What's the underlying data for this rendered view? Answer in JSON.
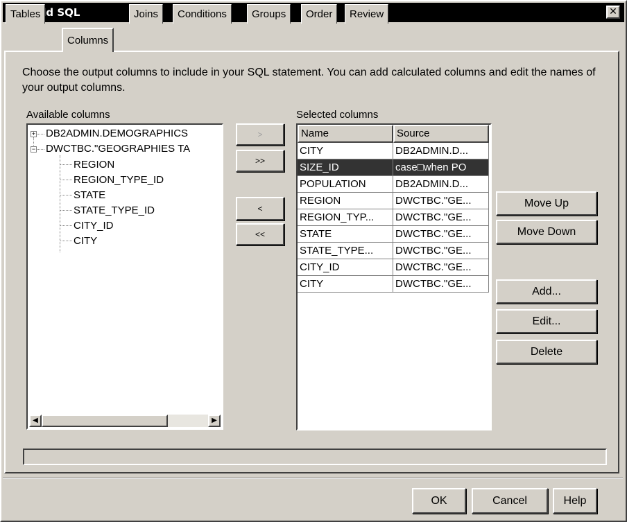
{
  "window": {
    "title": "Build SQL"
  },
  "tabs": [
    "Tables",
    "Columns",
    "Joins",
    "Conditions",
    "Groups",
    "Order",
    "Review"
  ],
  "active_tab": "Columns",
  "instructions": "Choose the output columns to include in your SQL statement.  You can add calculated columns and edit the names of your output columns.",
  "available": {
    "label": "Available columns",
    "tree": [
      {
        "text": "DB2ADMIN.DEMOGRAPHICS",
        "expander": "+"
      },
      {
        "text": "DWCTBC.\"GEOGRAPHIES TA",
        "expander": "−",
        "children": [
          "REGION",
          "REGION_TYPE_ID",
          "STATE",
          "STATE_TYPE_ID",
          "CITY_ID",
          "CITY"
        ]
      }
    ]
  },
  "move_buttons": {
    "add": ">",
    "add_all": ">>",
    "remove": "<",
    "remove_all": "<<"
  },
  "selected": {
    "label": "Selected columns",
    "headers": [
      "Name",
      "Source"
    ],
    "rows": [
      [
        "CITY",
        "DB2ADMIN.D..."
      ],
      [
        "SIZE_ID",
        "case□when PO"
      ],
      [
        "POPULATION",
        "DB2ADMIN.D..."
      ],
      [
        "REGION",
        "DWCTBC.\"GE..."
      ],
      [
        "REGION_TYP...",
        "DWCTBC.\"GE..."
      ],
      [
        "STATE",
        "DWCTBC.\"GE..."
      ],
      [
        "STATE_TYPE...",
        "DWCTBC.\"GE..."
      ],
      [
        "CITY_ID",
        "DWCTBC.\"GE..."
      ],
      [
        "CITY",
        "DWCTBC.\"GE..."
      ]
    ],
    "selected_row": 1
  },
  "side_buttons": {
    "move_up": "Move Up",
    "move_down": "Move Down",
    "add": "Add...",
    "edit": "Edit...",
    "delete": "Delete"
  },
  "footer": {
    "ok": "OK",
    "cancel": "Cancel",
    "help": "Help"
  },
  "status": ""
}
